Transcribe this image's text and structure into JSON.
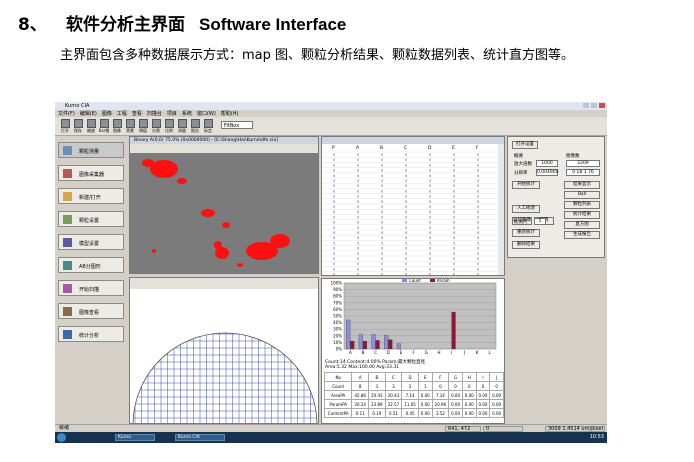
{
  "heading": {
    "number": "8、",
    "title_cn": "软件分析主界面",
    "title_en": "Software Interface"
  },
  "paragraph": "主界面包含多种数据展示方式：map 图、颗粒分析结果、颗粒数据列表、统计直方图等。",
  "app": {
    "window_title": "Kurno CIA",
    "menu": [
      "文件(F)",
      "编辑(E)",
      "图像",
      "工程",
      "查看",
      "扫描台",
      "项目",
      "系统",
      "窗口(W)",
      "帮助(H)"
    ],
    "toolbar_labels": [
      "打开",
      "保存",
      "缩放",
      "Kar格",
      "图像",
      "背景",
      "阈值",
      "分割",
      "比例",
      "测量",
      "报告",
      "标定"
    ],
    "zoom_value": "FitBox",
    "sidebar": [
      "颗粒测量",
      "图像采集器",
      "新建/打开",
      "颗粒设置",
      "模型设置",
      "AB分图形",
      "开始扫描",
      "图像查看",
      "统计分析"
    ],
    "image_panel_title": "Binary A(0,0) 75.0% (0x0000000) - [E:\\Shang\\Hai\\Kurno\\dfe.cia]",
    "analysis": {
      "open_button": "打开设置",
      "box1_title": "概要",
      "box2_title": "图像数",
      "rows": [
        {
          "label": "放大倍数",
          "value": "1000",
          "extra": "2209"
        },
        {
          "label": "分辨率",
          "value": "0.004900",
          "extra": "0 18 1 76"
        }
      ],
      "buttons_left": [
        "开始统计",
        "人工修改",
        "重新统计",
        "运行图像",
        "取消",
        "删除结果"
      ],
      "buttons_right": [
        "结果显示",
        "Ball",
        "颗粒列表",
        "统计结果",
        "直方图",
        "生成报告"
      ],
      "scale_label": "比例尺",
      "scale_value": "5"
    },
    "chart_data": {
      "type": "bar",
      "categories": [
        "A",
        "B",
        "C",
        "D",
        "E",
        "F",
        "G",
        "H",
        "I",
        "J",
        "K",
        "L"
      ],
      "series": [
        {
          "name": "Count",
          "values": [
            44,
            22,
            22,
            21,
            8,
            0,
            0,
            0,
            0,
            0,
            0,
            0
          ]
        },
        {
          "name": "Param",
          "values": [
            12,
            12,
            13,
            14,
            0,
            0,
            0,
            0,
            56,
            0,
            0,
            0
          ]
        }
      ],
      "ylim": [
        0,
        100
      ],
      "ytick_labels": [
        "100%",
        "90%",
        "80%",
        "70%",
        "60%",
        "50%",
        "40%",
        "30%",
        "20%",
        "10%",
        "0%"
      ]
    },
    "stats_lines": [
      "Count:14   Content:4.00%   Param:最大颗粒直径",
      "Area:5.32   Max:100.00   Avg:33.31"
    ],
    "stats_table": {
      "header": [
        "No",
        "A",
        "B",
        "C",
        "D",
        "E",
        "F",
        "G",
        "H",
        "I",
        "J"
      ],
      "rows": [
        [
          "Count",
          "8",
          "3",
          "3",
          "3",
          "1",
          "0",
          "0",
          "0",
          "0",
          "0"
        ],
        [
          "AreaPA",
          "42.86",
          "20.43",
          "20.43",
          "7.14",
          "0.00",
          "7.14",
          "0.00",
          "0.00",
          "0.00",
          "0.00"
        ],
        [
          "ParamPA",
          "20.24",
          "23.89",
          "22.57",
          "11.05",
          "0.00",
          "20.96",
          "0.00",
          "0.00",
          "0.00",
          "0.00"
        ],
        [
          "ContentPA",
          "0.11",
          "0.19",
          "0.51",
          "0.45",
          "0.00",
          "3.52",
          "0.00",
          "0.00",
          "0.00",
          "0.00"
        ]
      ]
    },
    "list_headers": [
      "P",
      "A",
      "B",
      "C",
      "D",
      "E",
      "F",
      "G"
    ],
    "status_left": "就绪",
    "status_coords": "641, 472",
    "status_zoom": "0",
    "status_right": "3009 1.4514 um/pixel",
    "taskbar": [
      "Kurno",
      "Kurno CIA"
    ],
    "clock": "10:53"
  }
}
